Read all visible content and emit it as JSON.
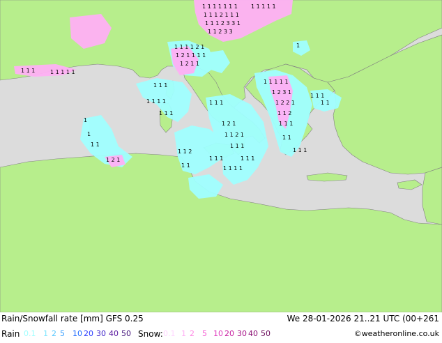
{
  "title": "Rain/Snowfall rate [mm] GFS 0.25",
  "datetime": "We 28-01-2026 21..21 UTC (00+261",
  "legend": {
    "rain_label": "Rain",
    "rain_values": [
      "0.1",
      "1",
      "2",
      "5",
      "10",
      "20",
      "30",
      "40",
      "50"
    ],
    "rain_colors": [
      "#a0ffff",
      "#7fe6ff",
      "#5ac8ff",
      "#3aa0ff",
      "#1e6bff",
      "#2a3cff",
      "#3a1fc8",
      "#5a1aa0",
      "#40107a"
    ],
    "snow_label": "Snow:",
    "snow_values": [
      "0.1",
      "1",
      "2",
      "5",
      "10",
      "20",
      "30",
      "40",
      "50"
    ],
    "snow_colors": [
      "#ffd6ff",
      "#ffb0f5",
      "#ff8ce6",
      "#f55ad2",
      "#e03cbe",
      "#c81ea0",
      "#a8148a",
      "#8a0e72",
      "#6a0a5a"
    ]
  },
  "credit": "©weatheronline.co.uk",
  "colors": {
    "land": "#b7ee8c",
    "sea": "#dcdcdc",
    "rain_area": "#a0ffff",
    "snow_area": "#ffb0f5",
    "border": "#808080"
  }
}
